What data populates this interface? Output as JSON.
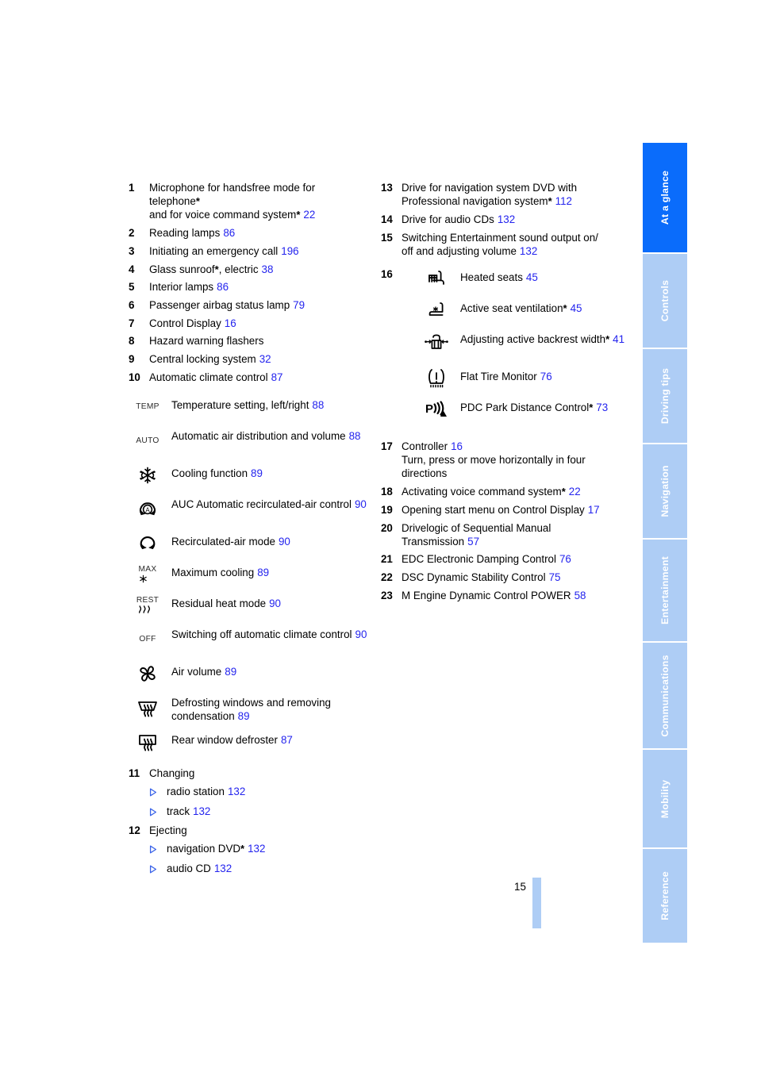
{
  "document": {
    "folio": "15",
    "link_color": "#2424ee",
    "active_tab_color": "#0a6cfb",
    "inactive_tab_color": "#aecdf5"
  },
  "tabs": [
    {
      "label": "At a glance",
      "active": true
    },
    {
      "label": "Controls",
      "active": false
    },
    {
      "label": "Driving tips",
      "active": false
    },
    {
      "label": "Navigation",
      "active": false
    },
    {
      "label": "Entertainment",
      "active": false
    },
    {
      "label": "Communications",
      "active": false
    },
    {
      "label": "Mobility",
      "active": false
    },
    {
      "label": "Reference",
      "active": false
    }
  ],
  "left_column": {
    "items": [
      {
        "num": "1",
        "line1": "Microphone for handsfree mode for",
        "line2": "telephone",
        "star2": "*",
        "line3": "and for voice command system",
        "star3": "*",
        "page": "22"
      },
      {
        "num": "2",
        "text": "Reading lamps",
        "page": "86"
      },
      {
        "num": "3",
        "text": "Initiating an emergency call",
        "page": "196"
      },
      {
        "num": "4",
        "text": "Glass sunroof",
        "star": "*",
        "text2": ", electric",
        "page": "38"
      },
      {
        "num": "5",
        "text": "Interior lamps",
        "page": "86"
      },
      {
        "num": "6",
        "text": "Passenger airbag status lamp",
        "page": "79"
      },
      {
        "num": "7",
        "text": "Control Display",
        "page": "16"
      },
      {
        "num": "8",
        "text": "Hazard warning flashers",
        "page": ""
      },
      {
        "num": "9",
        "text": "Central locking system",
        "page": "32"
      },
      {
        "num": "10",
        "text": "Automatic climate control",
        "page": "87"
      }
    ],
    "climate_icons": [
      {
        "icon": "temp-text-icon",
        "glyph_text": "TEMP",
        "label": "Temperature setting, left/right",
        "page": "88"
      },
      {
        "icon": "auto-text-icon",
        "glyph_text": "AUTO",
        "label": "Automatic air distribution and volume",
        "page": "88"
      },
      {
        "icon": "snowflake-icon",
        "glyph_text": "",
        "label": "Cooling function",
        "page": "89"
      },
      {
        "icon": "auc-recirculation-icon",
        "glyph_text": "",
        "label": "AUC Automatic recirculated-air control",
        "page": "90"
      },
      {
        "icon": "recirculated-air-icon",
        "glyph_text": "",
        "label": "Recirculated-air mode",
        "page": "90"
      },
      {
        "icon": "max-cooling-icon",
        "glyph_text": "MAX",
        "label": "Maximum cooling",
        "page": "89"
      },
      {
        "icon": "residual-heat-icon",
        "glyph_text": "REST",
        "label": "Residual heat mode",
        "page": "90"
      },
      {
        "icon": "off-text-icon",
        "glyph_text": "OFF",
        "label": "Switching off automatic climate control",
        "page": "90"
      },
      {
        "icon": "fan-air-volume-icon",
        "glyph_text": "",
        "label": "Air volume",
        "page": "89"
      },
      {
        "icon": "windshield-defrost-icon",
        "glyph_text": "",
        "label": "Defrosting windows and removing condensation",
        "page": "89"
      },
      {
        "icon": "rear-window-defroster-icon",
        "glyph_text": "",
        "label": "Rear window defroster",
        "page": "87"
      }
    ],
    "item11": {
      "num": "11",
      "text": "Changing",
      "bullets": [
        {
          "label": "radio station",
          "page": "132"
        },
        {
          "label": "track",
          "page": "132"
        }
      ]
    },
    "item12": {
      "num": "12",
      "text": "Ejecting",
      "bullets": [
        {
          "label": "navigation DVD",
          "star": "*",
          "page": "132"
        },
        {
          "label": "audio CD",
          "star": "",
          "page": "132"
        }
      ]
    }
  },
  "right_column": {
    "items_top": [
      {
        "num": "13",
        "line1": "Drive for navigation system DVD with",
        "line2": "Professional navigation system",
        "star": "*",
        "page": "112"
      },
      {
        "num": "14",
        "text": "Drive for audio CDs",
        "page": "132"
      },
      {
        "num": "15",
        "line1": "Switching Entertainment sound output on/",
        "line2": "off and adjusting volume",
        "page": "132"
      }
    ],
    "item16": {
      "num": "16",
      "icons": [
        {
          "icon": "heated-seat-icon",
          "label": "Heated seats",
          "star": "",
          "page": "45"
        },
        {
          "icon": "seat-ventilation-icon",
          "label": "Active seat ventilation",
          "star": "*",
          "page": "45"
        },
        {
          "icon": "backrest-width-icon",
          "label": "Adjusting active backrest width",
          "star": "*",
          "page": "41"
        },
        {
          "icon": "flat-tire-monitor-icon",
          "label": "Flat Tire Monitor",
          "star": "",
          "page": "76"
        },
        {
          "icon": "pdc-park-distance-icon",
          "label": "PDC Park Distance Control",
          "star": "*",
          "page": "73"
        }
      ]
    },
    "items_bottom": [
      {
        "num": "17",
        "line1": "Controller",
        "page": "16",
        "line2": "Turn, press or move horizontally in four",
        "line3": "directions"
      },
      {
        "num": "18",
        "text": "Activating voice command system",
        "star": "*",
        "page": "22"
      },
      {
        "num": "19",
        "text": "Opening start menu on Control Display",
        "page": "17"
      },
      {
        "num": "20",
        "line1": "Drivelogic of Sequential Manual",
        "line2": "Transmission",
        "page": "57"
      },
      {
        "num": "21",
        "text": "EDC Electronic Damping Control",
        "page": "76"
      },
      {
        "num": "22",
        "text": "DSC Dynamic Stability Control",
        "page": "75"
      },
      {
        "num": "23",
        "text": "M Engine Dynamic Control POWER",
        "page": "58"
      }
    ]
  }
}
